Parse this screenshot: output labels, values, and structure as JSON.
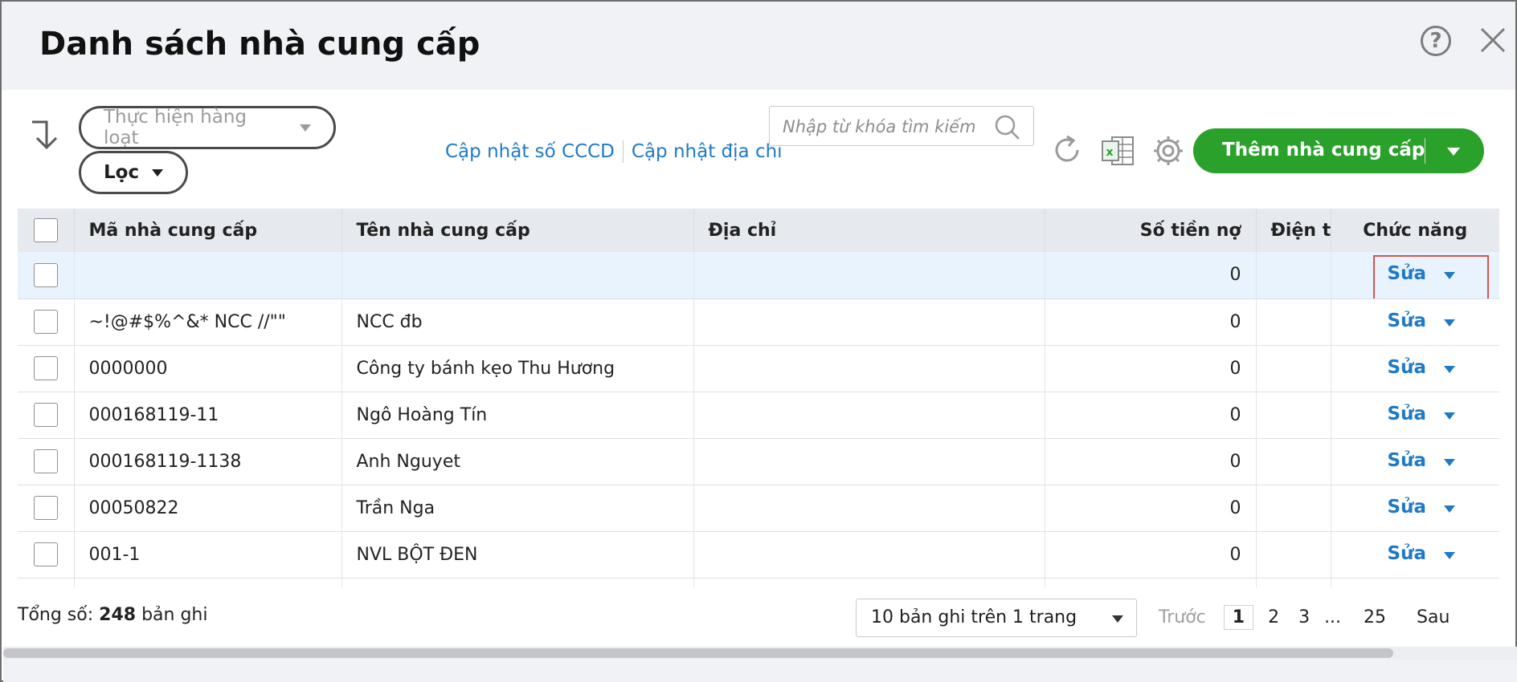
{
  "window": {
    "title": "Danh sách nhà cung cấp"
  },
  "toolbar": {
    "bulk_label": "Thực hiện hàng loạt",
    "filter_label": "Lọc",
    "link_update_id": "Cập nhật số CCCD",
    "link_update_address": "Cập nhật địa chỉ",
    "search_placeholder": "Nhập từ khóa tìm kiếm",
    "add_label": "Thêm nhà cung cấp"
  },
  "icons": {
    "sort": "sort-down-arrow-icon",
    "help": "question-circle-icon",
    "close": "close-icon",
    "search": "search-icon",
    "refresh": "refresh-icon",
    "excel": "excel-icon",
    "settings": "gear-icon"
  },
  "colors": {
    "accent_link": "#1f7ac6",
    "primary_button": "#2aa12b",
    "highlight_row": "#e8f3fd",
    "highlight_box": "#d9534f"
  },
  "table": {
    "headers": {
      "code": "Mã nhà cung cấp",
      "name": "Tên nhà cung cấp",
      "address": "Địa chỉ",
      "debt": "Số tiền nợ",
      "phone": "Điện th",
      "actions": "Chức năng"
    },
    "rows": [
      {
        "code": "",
        "name": "",
        "address": "",
        "debt": "0",
        "phone": "",
        "action": "Sửa"
      },
      {
        "code": "~!@#$%^&* NCC //\"\"",
        "name": "NCC đb",
        "address": "",
        "debt": "0",
        "phone": "",
        "action": "Sửa"
      },
      {
        "code": "0000000",
        "name": "Công ty bánh kẹo Thu Hương",
        "address": "",
        "debt": "0",
        "phone": "",
        "action": "Sửa"
      },
      {
        "code": "000168119-11",
        "name": "Ngô Hoàng Tín",
        "address": "",
        "debt": "0",
        "phone": "",
        "action": "Sửa"
      },
      {
        "code": "000168119-1138",
        "name": "Anh Nguyet",
        "address": "",
        "debt": "0",
        "phone": "",
        "action": "Sửa"
      },
      {
        "code": "00050822",
        "name": "Trần Nga",
        "address": "",
        "debt": "0",
        "phone": "",
        "action": "Sửa"
      },
      {
        "code": "001-1",
        "name": "NVL BỘT ĐEN",
        "address": "",
        "debt": "0",
        "phone": "",
        "action": "Sửa"
      }
    ]
  },
  "footer": {
    "total_prefix": "Tổng số:",
    "total_count": "248",
    "total_suffix": "bản ghi",
    "page_size": "10 bản ghi trên 1 trang",
    "prev": "Trước",
    "pages": [
      "1",
      "2",
      "3"
    ],
    "ellipsis": "...",
    "last_page": "25",
    "next": "Sau"
  }
}
